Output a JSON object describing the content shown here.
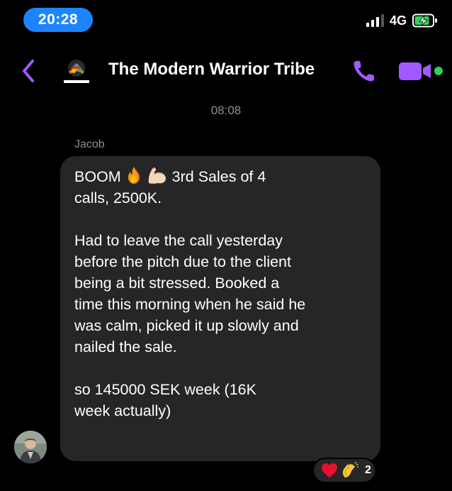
{
  "status_bar": {
    "time": "20:28",
    "network": "4G"
  },
  "header": {
    "title": "The Modern Warrior Tribe",
    "accent_color": "#a259ff",
    "online_color": "#31d158"
  },
  "conversation": {
    "timestamp": "08:08",
    "message": {
      "sender": "Jacob",
      "line1_start": "BOOM",
      "line1_end": "3rd Sales of 4",
      "line2": "calls, 2500K.",
      "paragraph2": [
        "Had to leave the call yesterday",
        "before the pitch due to the client",
        "being a bit stressed. Booked a",
        "time this morning when he said he",
        "was calm, picked it up slowly and",
        "nailed the sale."
      ],
      "paragraph3": [
        "so 145000 SEK week (16K",
        "week actually)"
      ],
      "emojis": [
        "fire-icon",
        "flexed-biceps-icon"
      ],
      "reactions": {
        "icons": [
          "red-heart-icon",
          "clapping-hands-icon"
        ],
        "count": "2"
      }
    }
  }
}
